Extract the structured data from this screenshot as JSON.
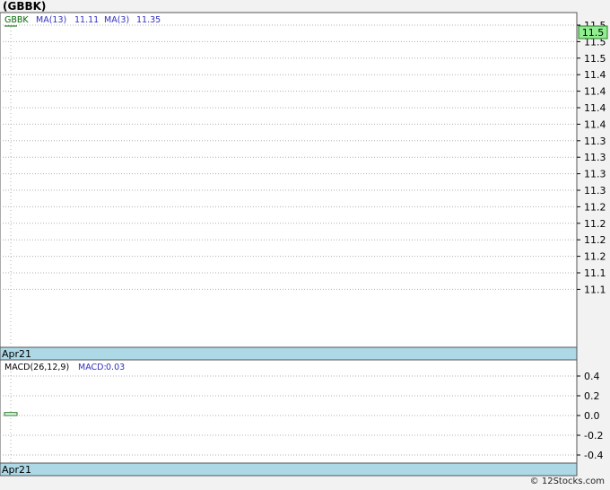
{
  "title": "(GBBK)",
  "credit": "© 12Stocks.com",
  "colors": {
    "price_legend": "#006600",
    "ma_legend": "#3030c0",
    "band": "#add8e6",
    "grid": "#b0b0b0",
    "last_box": "#90ee90",
    "macd_legend": "#000000"
  },
  "chart_data": [
    {
      "type": "line",
      "panel": "price",
      "symbol": "GBBK",
      "legend": [
        {
          "label": "GBBK",
          "value": ""
        },
        {
          "label": "MA(13)",
          "value": "11.11"
        },
        {
          "label": "MA(3)",
          "value": "11.35"
        }
      ],
      "y_tick_labels": [
        "11.5",
        "11.5",
        "11.5",
        "11.4",
        "11.4",
        "11.4",
        "11.4",
        "11.3",
        "11.3",
        "11.3",
        "11.3",
        "11.2",
        "11.2",
        "11.2",
        "11.2",
        "11.1",
        "11.1"
      ],
      "last_price_label": "11.5",
      "x_label": "Apr21",
      "grid": true
    },
    {
      "type": "line",
      "panel": "macd",
      "legend": [
        {
          "label": "MACD(26,12,9)",
          "value": ""
        },
        {
          "label": "MACD:",
          "value": "0.03"
        }
      ],
      "y_ticks": [
        "0.4",
        "0.2",
        "0.0",
        "-0.2",
        "-0.4"
      ],
      "ylim": [
        -0.5,
        0.5
      ],
      "x_label": "Apr21",
      "histogram_last": 0.03,
      "grid": true
    }
  ]
}
